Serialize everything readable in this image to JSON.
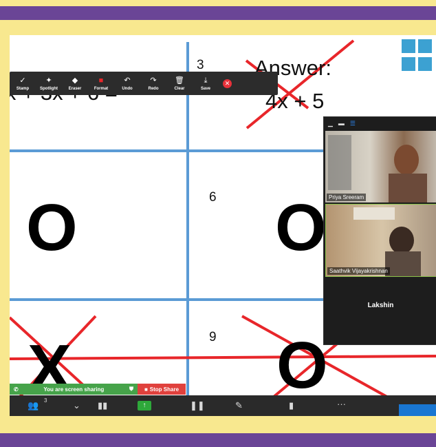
{
  "colors": {
    "frame": "#f8e88f",
    "band": "#6a4596",
    "grid": "#5b9bd5",
    "cross": "#e8262a",
    "share_green": "#46a34a",
    "stop_red": "#e0413d"
  },
  "slide": {
    "partial_equation": "x + 3x + 6 =",
    "cell_numbers": [
      "3",
      "6",
      "9"
    ],
    "answer_label": "Answer:",
    "answer_value": "4x + 5",
    "o_mark": "O",
    "x_mark": "X"
  },
  "annotation_toolbar": {
    "tools": [
      {
        "label": "Stamp",
        "icon": "check-icon",
        "glyph": "✓"
      },
      {
        "label": "Spotlight",
        "icon": "wand-icon",
        "glyph": "✦"
      },
      {
        "label": "Eraser",
        "icon": "eraser-icon",
        "glyph": "◆"
      },
      {
        "label": "Format",
        "icon": "format-icon",
        "glyph": "■"
      },
      {
        "label": "Undo",
        "icon": "undo-icon",
        "glyph": "↶"
      },
      {
        "label": "Redo",
        "icon": "redo-icon",
        "glyph": "↷"
      },
      {
        "label": "Clear",
        "icon": "trash-icon",
        "glyph": "🗑"
      },
      {
        "label": "Save",
        "icon": "save-icon",
        "glyph": "⤓"
      }
    ],
    "close_glyph": "✕"
  },
  "video_panel": {
    "participants": [
      {
        "name": "Priya Sreeram"
      },
      {
        "name": "Saathvik Vijayakrishnan"
      },
      {
        "name": "Lakshin"
      }
    ]
  },
  "share_bar": {
    "status": "You are screen sharing",
    "stop_label": "Stop Share"
  },
  "meeting_bar": {
    "participant_count": "3",
    "more_glyph": "···"
  }
}
